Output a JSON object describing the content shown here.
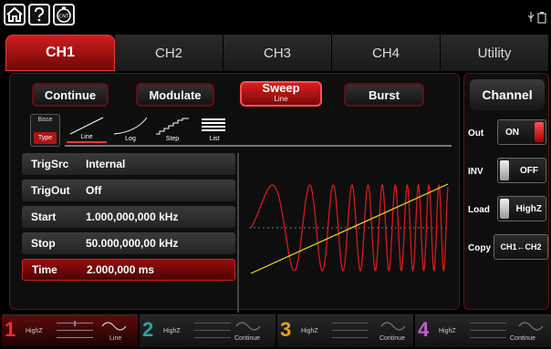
{
  "tabs": [
    {
      "label": "CH1",
      "active": true
    },
    {
      "label": "CH2",
      "active": false
    },
    {
      "label": "CH3",
      "active": false
    },
    {
      "label": "CH4",
      "active": false
    },
    {
      "label": "Utility",
      "active": false
    }
  ],
  "mode_buttons": {
    "continue": "Continue",
    "modulate": "Modulate",
    "sweep": "Sweep",
    "sweep_sub": "Line",
    "burst": "Burst"
  },
  "sweep_types": {
    "base": "Base",
    "type": "Type",
    "items": [
      "Line",
      "Log",
      "Step",
      "List"
    ],
    "active": "Line"
  },
  "params": [
    {
      "name": "TrigSrc",
      "value": "Internal"
    },
    {
      "name": "TrigOut",
      "value": "Off"
    },
    {
      "name": "Start",
      "value": "1.000,000,000 kHz"
    },
    {
      "name": "Stop",
      "value": "50.000,000,00 kHz"
    },
    {
      "name": "Time",
      "value": "2.000,000 ms"
    }
  ],
  "channel_panel": {
    "title": "Channel",
    "out_label": "Out",
    "out_value": "ON",
    "inv_label": "INV",
    "inv_value": "OFF",
    "load_label": "Load",
    "load_value": "HighZ",
    "copy_label": "Copy",
    "copy_value": "CH1←CH2"
  },
  "bottom_channels": [
    {
      "num": "1",
      "load": "HighZ",
      "mode": "Line",
      "color": "#ff2a2a"
    },
    {
      "num": "2",
      "load": "HighZ",
      "mode": "Continue",
      "color": "#2aa7a0"
    },
    {
      "num": "3",
      "load": "HighZ",
      "mode": "Continue",
      "color": "#e3a21a"
    },
    {
      "num": "4",
      "load": "HighZ",
      "mode": "Continue",
      "color": "#c55bd8"
    }
  ],
  "colors": {
    "accent": "#c81414",
    "wave": "#d81818",
    "ramp": "#f0e020"
  },
  "icons": [
    "home-icon",
    "help-icon",
    "cnt-icon",
    "usb-icon",
    "battery-icon"
  ]
}
